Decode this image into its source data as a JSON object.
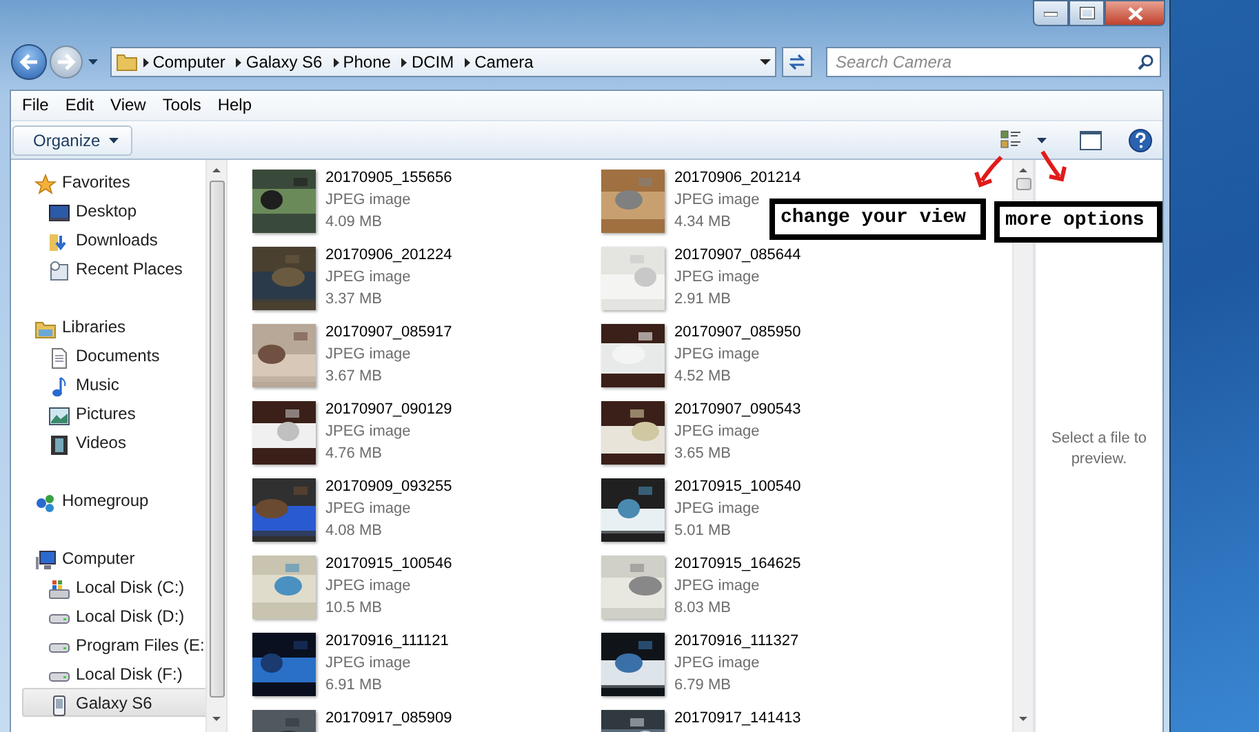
{
  "address": {
    "path": [
      "Computer",
      "Galaxy S6",
      "Phone",
      "DCIM",
      "Camera"
    ]
  },
  "search": {
    "placeholder": "Search Camera"
  },
  "menu": [
    "File",
    "Edit",
    "View",
    "Tools",
    "Help"
  ],
  "toolbar": {
    "organize": "Organize"
  },
  "nav": [
    {
      "label": "Favorites",
      "kind": "favorites",
      "selected": false,
      "children": [
        {
          "label": "Desktop",
          "kind": "desktop",
          "selected": false
        },
        {
          "label": "Downloads",
          "kind": "downloads",
          "selected": false
        },
        {
          "label": "Recent Places",
          "kind": "recent",
          "selected": false
        }
      ]
    },
    {
      "label": "Libraries",
      "kind": "libraries",
      "selected": false,
      "children": [
        {
          "label": "Documents",
          "kind": "documents",
          "selected": false
        },
        {
          "label": "Music",
          "kind": "music",
          "selected": false
        },
        {
          "label": "Pictures",
          "kind": "pictures",
          "selected": false
        },
        {
          "label": "Videos",
          "kind": "videos",
          "selected": false
        }
      ]
    },
    {
      "label": "Homegroup",
      "kind": "homegroup",
      "selected": false
    },
    {
      "label": "Computer",
      "kind": "computer",
      "selected": false,
      "children": [
        {
          "label": "Local Disk (C:)",
          "kind": "system-disk",
          "selected": false
        },
        {
          "label": "Local Disk (D:)",
          "kind": "disk",
          "selected": false
        },
        {
          "label": "Program Files (E:",
          "kind": "disk",
          "selected": false
        },
        {
          "label": "Local Disk (F:)",
          "kind": "disk",
          "selected": false
        },
        {
          "label": "Galaxy S6",
          "kind": "phone",
          "selected": true
        }
      ]
    }
  ],
  "files": [
    {
      "name": "20170905_155656",
      "type": "JPEG image",
      "size": "4.09 MB"
    },
    {
      "name": "20170906_201214",
      "type": "JPEG image",
      "size": "4.34 MB"
    },
    {
      "name": "20170906_201224",
      "type": "JPEG image",
      "size": "3.37 MB"
    },
    {
      "name": "20170907_085644",
      "type": "JPEG image",
      "size": "2.91 MB"
    },
    {
      "name": "20170907_085917",
      "type": "JPEG image",
      "size": "3.67 MB"
    },
    {
      "name": "20170907_085950",
      "type": "JPEG image",
      "size": "4.52 MB"
    },
    {
      "name": "20170907_090129",
      "type": "JPEG image",
      "size": "4.76 MB"
    },
    {
      "name": "20170907_090543",
      "type": "JPEG image",
      "size": "3.65 MB"
    },
    {
      "name": "20170909_093255",
      "type": "JPEG image",
      "size": "4.08 MB"
    },
    {
      "name": "20170915_100540",
      "type": "JPEG image",
      "size": "5.01 MB"
    },
    {
      "name": "20170915_100546",
      "type": "JPEG image",
      "size": "10.5 MB"
    },
    {
      "name": "20170915_164625",
      "type": "JPEG image",
      "size": "8.03 MB"
    },
    {
      "name": "20170916_111121",
      "type": "JPEG image",
      "size": "6.91 MB"
    },
    {
      "name": "20170916_111327",
      "type": "JPEG image",
      "size": "6.79 MB"
    },
    {
      "name": "20170917_085909"
    },
    {
      "name": "20170917_141413"
    }
  ],
  "preview": {
    "message": "Select a file to preview."
  },
  "callouts": [
    {
      "text": "change your view"
    },
    {
      "text": "more options"
    }
  ]
}
